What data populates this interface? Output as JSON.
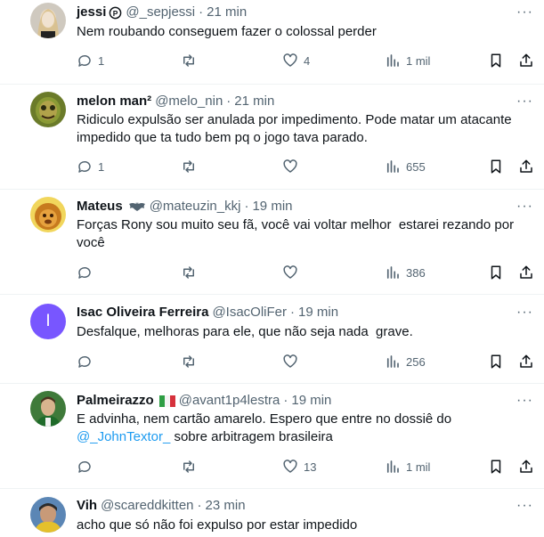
{
  "tweets": [
    {
      "name": "jessi",
      "badge_icon": "circle-p-icon",
      "handle": "@_sepjessi",
      "time": "21 min",
      "lines": [
        "Nem roubando conseguem fazer o colossal perder"
      ],
      "replies": "1",
      "retweets": "",
      "likes": "4",
      "views": "1 mil"
    },
    {
      "name": "melon man²",
      "handle": "@melo_nin",
      "time": "21 min",
      "lines": [
        "Ridiculo expulsão ser anulada por impedimento. Pode matar um atacante",
        "impedido que ta tudo bem pq o jogo tava parado."
      ],
      "replies": "1",
      "retweets": "",
      "likes": "",
      "views": "655"
    },
    {
      "name": "Mateus",
      "badge_icon": "bat-icon",
      "handle": "@mateuzin_kkj",
      "time": "19 min",
      "lines": [
        "Forças Rony sou muito seu fã, você vai voltar melhor  estarei rezando por",
        "você"
      ],
      "replies": "",
      "retweets": "",
      "likes": "",
      "views": "386"
    },
    {
      "name": "Isac Oliveira Ferreira",
      "avatar_letter": "I",
      "handle": "@IsacOliFer",
      "time": "19 min",
      "lines": [
        "Desfalque, melhoras para ele, que não seja nada  grave."
      ],
      "replies": "",
      "retweets": "",
      "likes": "",
      "views": "256"
    },
    {
      "name": "Palmeirazzo",
      "badge_icon": "italy-flag-icon",
      "handle": "@avant1p4lestra",
      "time": "19 min",
      "lines": [
        "E advinha, nem cartão amarelo. Espero que entre no dossiê do"
      ],
      "mention": "@_JohnTextor_",
      "mention_tail": " sobre arbitragem brasileira",
      "replies": "",
      "retweets": "",
      "likes": "13",
      "views": "1 mil"
    },
    {
      "name": "Vih",
      "handle": "@scareddkitten",
      "time": "23 min",
      "lines": [
        "acho que só não foi expulso por estar impedido"
      ]
    }
  ],
  "dot": "·",
  "more": "···",
  "colors": {
    "text": "#0f1419",
    "muted": "#536471",
    "link": "#1d9bf0",
    "letter_avatar": "#7856ff"
  }
}
